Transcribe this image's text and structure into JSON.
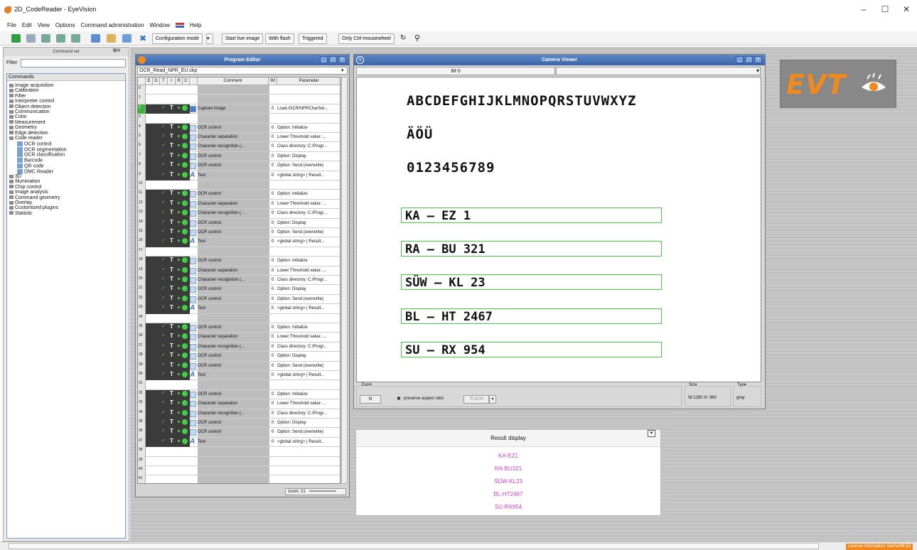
{
  "window": {
    "title": "2D_CodeReader - EyeVision",
    "minimize": "–",
    "maximize": "☐",
    "close": "✕"
  },
  "menu": [
    "File",
    "Edit",
    "View",
    "Options",
    "Command administration",
    "Window",
    "Help"
  ],
  "toolbar": {
    "config_mode": "Configuration mode",
    "start_live": "Start live image",
    "with_flash": "With flash",
    "triggered": "Triggered",
    "ctrl_wheel": "Only Ctrl-mousewheel"
  },
  "command_set": {
    "title": "Command set",
    "filter_label": "Filter",
    "filter_value": "",
    "header": "Commands",
    "items": [
      {
        "label": "Image acquisition",
        "level": 0
      },
      {
        "label": "Calibration",
        "level": 0
      },
      {
        "label": "Filter",
        "level": 0
      },
      {
        "label": "Interpreter control",
        "level": 0
      },
      {
        "label": "Object detection",
        "level": 0
      },
      {
        "label": "Communication",
        "level": 0
      },
      {
        "label": "Color",
        "level": 0
      },
      {
        "label": "Measurement",
        "level": 0
      },
      {
        "label": "Geometry",
        "level": 0
      },
      {
        "label": "Edge detection",
        "level": 0
      },
      {
        "label": "Code reader",
        "level": 0
      },
      {
        "label": "OCR control",
        "level": 1
      },
      {
        "label": "OCR segmentation",
        "level": 1
      },
      {
        "label": "OCR classification",
        "level": 1
      },
      {
        "label": "Barcode",
        "level": 1
      },
      {
        "label": "QR code",
        "level": 1
      },
      {
        "label": "DMC Reader",
        "level": 1
      },
      {
        "label": "3D",
        "level": 0
      },
      {
        "label": "Illumination",
        "level": 0
      },
      {
        "label": "Chip control",
        "level": 0
      },
      {
        "label": "Image analysis",
        "level": 0
      },
      {
        "label": "Command geometry",
        "level": 0
      },
      {
        "label": "Overlay",
        "level": 0
      },
      {
        "label": "Customized plugins",
        "level": 0
      },
      {
        "label": "Statistic",
        "level": 0
      }
    ]
  },
  "program_editor": {
    "title": "Program Editor",
    "file": "OCR_Read_NPR_EU.ckp",
    "columns": [
      "E",
      "G",
      "T",
      "I",
      "R",
      "C",
      "Comment",
      "IM",
      "Parameter"
    ],
    "zoom": "zoom: 21",
    "rows": [
      {
        "n": "0",
        "c": "",
        "im": "",
        "p": ""
      },
      {
        "n": "1",
        "c": "",
        "im": "",
        "p": ""
      },
      {
        "n": "2",
        "c": "Capture image",
        "im": "0",
        "p": "Load./OCR/NPRCharSet..."
      },
      {
        "n": "3",
        "c": "",
        "im": "",
        "p": ""
      },
      {
        "n": "4",
        "c": "OCR control",
        "im": "0",
        "p": "Option: Initialize"
      },
      {
        "n": "5",
        "c": "Character separation",
        "im": "0",
        "p": "Lower Threshold value: ..."
      },
      {
        "n": "6",
        "c": "Character recognition (...",
        "im": "0",
        "p": "Class directory: C:/Progr..."
      },
      {
        "n": "7",
        "c": "OCR control",
        "im": "0",
        "p": "Option: Display"
      },
      {
        "n": "8",
        "c": "OCR control",
        "im": "0",
        "p": "Option: Send (overwrite)"
      },
      {
        "n": "9",
        "c": "Text",
        "im": "0",
        "p": "<global string> | Result..."
      },
      {
        "n": "10",
        "c": "",
        "im": "",
        "p": ""
      },
      {
        "n": "11",
        "c": "OCR control",
        "im": "0",
        "p": "Option: Initialize"
      },
      {
        "n": "12",
        "c": "Character separation",
        "im": "0",
        "p": "Lower Threshold value: ..."
      },
      {
        "n": "13",
        "c": "Character recognition (...",
        "im": "0",
        "p": "Class directory: C:/Progr..."
      },
      {
        "n": "14",
        "c": "OCR control",
        "im": "0",
        "p": "Option: Display"
      },
      {
        "n": "15",
        "c": "OCR control",
        "im": "0",
        "p": "Option: Send (overwrite)"
      },
      {
        "n": "16",
        "c": "Text",
        "im": "0",
        "p": "<global string> | Result..."
      },
      {
        "n": "17",
        "c": "",
        "im": "",
        "p": ""
      },
      {
        "n": "18",
        "c": "OCR control",
        "im": "0",
        "p": "Option: Initialize"
      },
      {
        "n": "19",
        "c": "Character separation",
        "im": "0",
        "p": "Lower Threshold value: ..."
      },
      {
        "n": "20",
        "c": "Character recognition (...",
        "im": "0",
        "p": "Class directory: C:/Progr..."
      },
      {
        "n": "21",
        "c": "OCR control",
        "im": "0",
        "p": "Option: Display"
      },
      {
        "n": "22",
        "c": "OCR control",
        "im": "0",
        "p": "Option: Send (overwrite)"
      },
      {
        "n": "23",
        "c": "Text",
        "im": "0",
        "p": "<global string> | Result..."
      },
      {
        "n": "24",
        "c": "",
        "im": "",
        "p": ""
      },
      {
        "n": "25",
        "c": "OCR control",
        "im": "0",
        "p": "Option: Initialize"
      },
      {
        "n": "26",
        "c": "Character separation",
        "im": "0",
        "p": "Lower Threshold value: ..."
      },
      {
        "n": "27",
        "c": "Character recognition (...",
        "im": "0",
        "p": "Class directory: C:/Progr..."
      },
      {
        "n": "28",
        "c": "OCR control",
        "im": "0",
        "p": "Option: Display"
      },
      {
        "n": "29",
        "c": "OCR control",
        "im": "0",
        "p": "Option: Send (overwrite)"
      },
      {
        "n": "30",
        "c": "Text",
        "im": "0",
        "p": "<global string> | Result..."
      },
      {
        "n": "31",
        "c": "",
        "im": "",
        "p": ""
      },
      {
        "n": "32",
        "c": "OCR control",
        "im": "0",
        "p": "Option: Initialize"
      },
      {
        "n": "33",
        "c": "Character separation",
        "im": "0",
        "p": "Lower Threshold value: ..."
      },
      {
        "n": "34",
        "c": "Character recognition (...",
        "im": "0",
        "p": "Class directory: C:/Progr..."
      },
      {
        "n": "35",
        "c": "OCR control",
        "im": "0",
        "p": "Option: Display"
      },
      {
        "n": "36",
        "c": "OCR control",
        "im": "0",
        "p": "Option: Send (overwrite)"
      },
      {
        "n": "37",
        "c": "Text",
        "im": "0",
        "p": "<global string> | Result..."
      },
      {
        "n": "38",
        "c": "",
        "im": "",
        "p": ""
      },
      {
        "n": "39",
        "c": "",
        "im": "",
        "p": ""
      },
      {
        "n": "40",
        "c": "",
        "im": "",
        "p": ""
      },
      {
        "n": "41",
        "c": "",
        "im": "",
        "p": ""
      }
    ]
  },
  "camera_viewer": {
    "title": "Camera Viewer",
    "tab": "IM 0",
    "line1": "ABCDEFGHIJKLMNOPQRSTUVWXYZ",
    "line2": "ÄÖÜ",
    "line3": "0123456789",
    "plates": [
      "KA – EZ 1",
      "RA – BU 321",
      "SÜW – KL 23",
      "BL – HT 2467",
      "SU – RX 954"
    ],
    "zoom_label": "Zoom",
    "fit": "fit",
    "preserve": "preserve aspect ratio",
    "zoom_value": "70.62%",
    "size_label": "Size",
    "size_value": "W:1280 H: 960",
    "type_label": "Type",
    "type_value": "gray"
  },
  "result_display": {
    "title": "Result display",
    "results": [
      "KA-EZ1",
      "RA-BU321",
      "SÜW-KL23",
      "BL-HT2467",
      "SU-RX954"
    ]
  },
  "brand": {
    "logo": "EVT"
  },
  "status": {
    "license": "License information: Demo/98.53"
  },
  "colors": {
    "accent_blue": "#3c64a8",
    "result_magenta": "#d23ed6",
    "ok_green": "#44cc44",
    "brand_orange": "#f08a20"
  }
}
